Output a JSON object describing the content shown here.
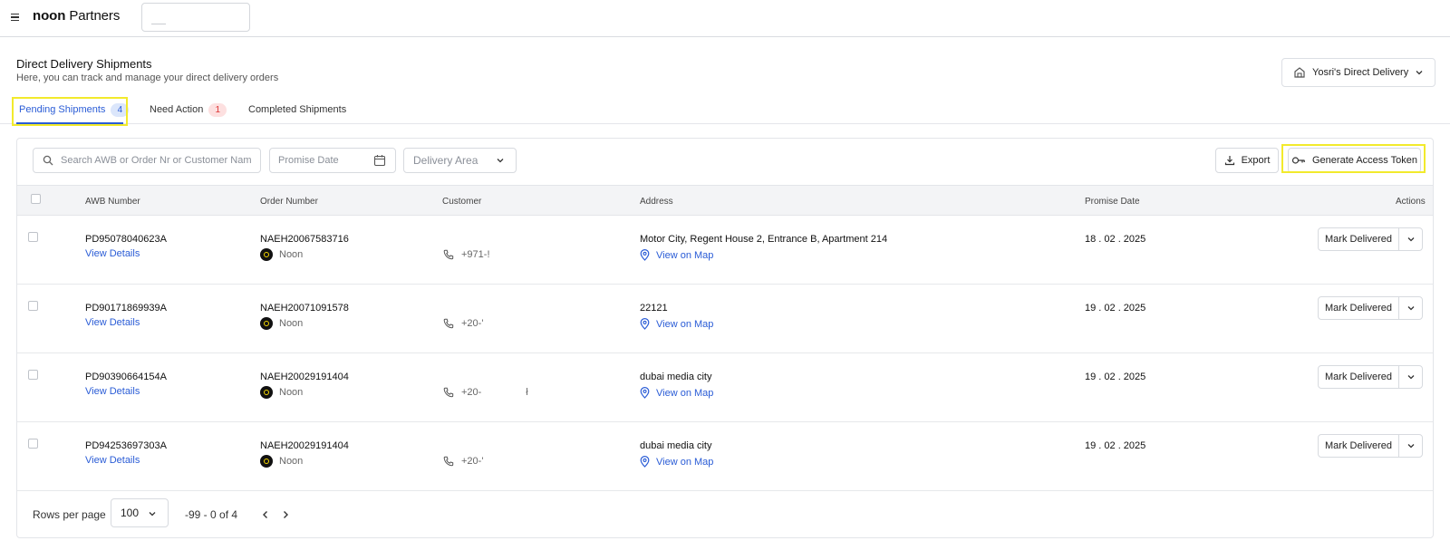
{
  "topbar": {
    "brand_bold": "noon",
    "brand_rest": " Partners"
  },
  "header": {
    "title": "Direct Delivery Shipments",
    "subtitle": "Here, you can track and manage your direct delivery orders",
    "store": "Yosri's Direct Delivery"
  },
  "tabs": [
    {
      "label": "Pending Shipments",
      "count": "4"
    },
    {
      "label": "Need Action",
      "count": "1"
    },
    {
      "label": "Completed Shipments"
    }
  ],
  "filters": {
    "search_placeholder": "Search AWB or Order Nr or Customer Name",
    "date_placeholder": "Promise Date",
    "area_placeholder": "Delivery Area",
    "export_label": "Export",
    "token_label": "Generate Access Token"
  },
  "table": {
    "columns": [
      "AWB Number",
      "Order Number",
      "Customer",
      "Address",
      "Promise Date",
      "Actions"
    ],
    "view_details": "View Details",
    "view_map": "View on Map",
    "mark_delivered": "Mark Delivered",
    "rows": [
      {
        "awb": "PD95078040623A",
        "order": "NAEH20067583716",
        "seller": "Noon",
        "phone": "+971-!",
        "address": "Motor City, Regent House 2, Entrance B, Apartment 214",
        "date": "18 . 02 . 2025"
      },
      {
        "awb": "PD90171869939A",
        "order": "NAEH20071091578",
        "seller": "Noon",
        "phone": "+20-'",
        "address": "22121",
        "date": "19 . 02 . 2025"
      },
      {
        "awb": "PD90390664154A",
        "order": "NAEH20029191404",
        "seller": "Noon",
        "phone": "+20-                ł",
        "address": "dubai media city",
        "date": "19 . 02 . 2025"
      },
      {
        "awb": "PD94253697303A",
        "order": "NAEH20029191404",
        "seller": "Noon",
        "phone": "+20-'",
        "address": "dubai media city",
        "date": "19 . 02 . 2025"
      }
    ]
  },
  "pagination": {
    "rows_label": "Rows per page",
    "rows_value": "100",
    "range": "-99 - 0 of 4"
  }
}
